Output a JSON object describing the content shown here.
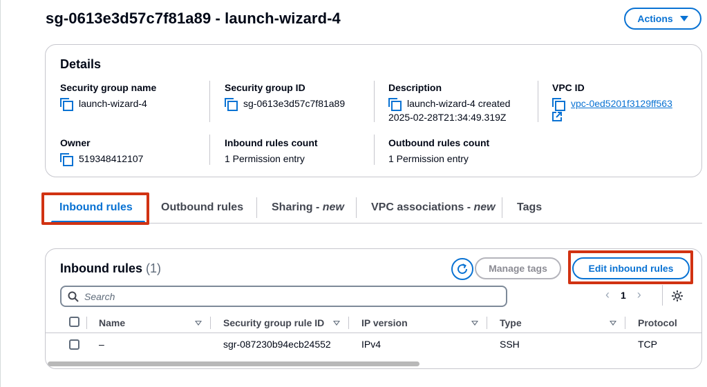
{
  "header": {
    "title": "sg-0613e3d57c7f81a89 - launch-wizard-4",
    "actions_label": "Actions"
  },
  "details": {
    "title": "Details",
    "fields": {
      "sg_name": {
        "label": "Security group name",
        "value": "launch-wizard-4"
      },
      "sg_id": {
        "label": "Security group ID",
        "value": "sg-0613e3d57c7f81a89"
      },
      "description": {
        "label": "Description",
        "line1": "launch-wizard-4 created",
        "line2": "2025-02-28T21:34:49.319Z"
      },
      "vpc_id": {
        "label": "VPC ID",
        "value": "vpc-0ed5201f3129ff563"
      },
      "owner": {
        "label": "Owner",
        "value": "519348412107"
      },
      "inbound_count": {
        "label": "Inbound rules count",
        "value": "1 Permission entry"
      },
      "outbound_count": {
        "label": "Outbound rules count",
        "value": "1 Permission entry"
      }
    }
  },
  "tabs": {
    "inbound": "Inbound rules",
    "outbound": "Outbound rules",
    "sharing": "Sharing - ",
    "sharing_new": "new",
    "vpc_assoc": "VPC associations - ",
    "vpc_assoc_new": "new",
    "tags": "Tags"
  },
  "rules": {
    "title": "Inbound rules",
    "count": "(1)",
    "manage_tags_label": "Manage tags",
    "edit_label": "Edit inbound rules",
    "search_placeholder": "Search",
    "page": "1",
    "columns": {
      "name": "Name",
      "rule_id": "Security group rule ID",
      "ip_version": "IP version",
      "type": "Type",
      "protocol": "Protocol"
    },
    "rows": [
      {
        "name": "–",
        "rule_id": "sgr-087230b94ecb24552",
        "ip_version": "IPv4",
        "type": "SSH",
        "protocol": "TCP"
      }
    ]
  },
  "colors": {
    "accent": "#0972d3",
    "highlight": "#d13212",
    "disabled": "#8c8c94"
  }
}
